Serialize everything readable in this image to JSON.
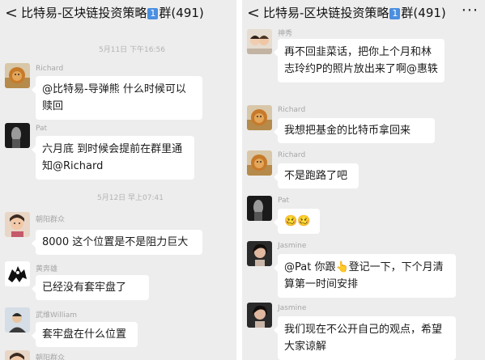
{
  "left": {
    "header": {
      "back": "<",
      "title": "比特易-区块链投资策略",
      "badge": "1",
      "title_suffix": "群(491)"
    },
    "timestamps": [
      "5月11日 下午16:56",
      "5月12日 早上07:41"
    ],
    "messages": [
      {
        "nick": "Richard",
        "text": "@比特易-导弹熊  什么时候可以赎回"
      },
      {
        "nick": "Pat",
        "text": "六月底 到时候会提前在群里通知@Richard"
      },
      {
        "nick": "朝阳群众",
        "text": "8000 这个位置是不是阻力巨大"
      },
      {
        "nick": "黄奔雄",
        "text": "已经没有套牢盘了"
      },
      {
        "nick": "武维William",
        "text": "套牢盘在什么位置"
      },
      {
        "nick": "朝阳群众",
        "text": ""
      }
    ]
  },
  "right": {
    "header": {
      "back": "<",
      "title": "比特易-区块链投资策略",
      "badge": "1",
      "title_suffix": "群(491)",
      "more": "···"
    },
    "messages": [
      {
        "nick": "神秀",
        "text": "再不回韭菜话，把你上个月和林志玲约P的照片放出来了啊@惠轶"
      },
      {
        "nick": "Richard",
        "text": "我想把基金的比特币拿回来"
      },
      {
        "nick": "Richard",
        "text": "不是跑路了吧"
      },
      {
        "nick": "Pat",
        "text": "🥴🥴"
      },
      {
        "nick": "Jasmine",
        "text": "@Pat  你跟👆登记一下，下个月清算第一时间安排"
      },
      {
        "nick": "Jasmine",
        "text": "我们现在不公开自己的观点，希望大家谅解"
      }
    ]
  }
}
